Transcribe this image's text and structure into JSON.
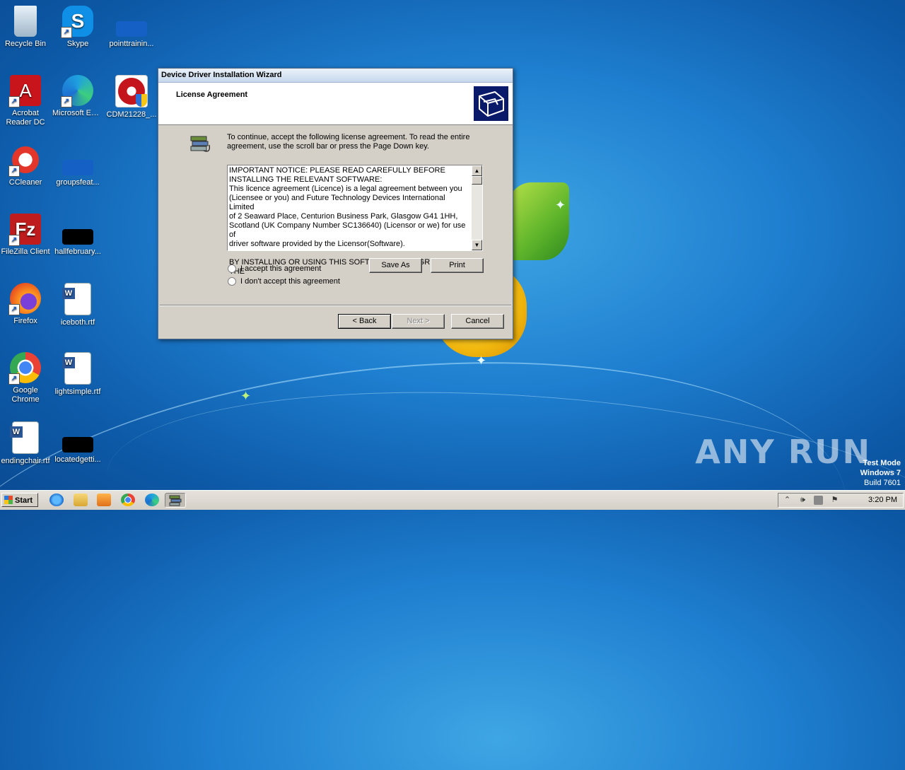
{
  "desktop": {
    "icons": [
      {
        "label": "Recycle Bin"
      },
      {
        "label": "Skype"
      },
      {
        "label": "pointtrainin..."
      },
      {
        "label": "Acrobat Reader DC"
      },
      {
        "label": "Microsoft Edge"
      },
      {
        "label": "CDM21228_..."
      },
      {
        "label": "CCleaner"
      },
      {
        "label": "groupsfeat..."
      },
      {
        "label": "FileZilla Client"
      },
      {
        "label": "hallfebruary..."
      },
      {
        "label": "Firefox"
      },
      {
        "label": "iceboth.rtf"
      },
      {
        "label": "Google Chrome"
      },
      {
        "label": "lightsimple.rtf"
      },
      {
        "label": "endingchair.rtf"
      },
      {
        "label": "locatedgetti..."
      }
    ],
    "watermark": "ANY RUN",
    "test_mode": {
      "line1": "Test Mode",
      "line2": "Windows 7",
      "line3": "Build 7601"
    }
  },
  "dialog": {
    "title": "Device Driver Installation Wizard",
    "header_title": "License Agreement",
    "instructions": "To continue, accept the following license agreement. To read the entire agreement, use the scroll bar or press the Page Down key.",
    "license_lines": [
      "IMPORTANT NOTICE: PLEASE READ CAREFULLY BEFORE",
      "INSTALLING THE RELEVANT SOFTWARE:",
      "This licence agreement (Licence) is a legal agreement between you",
      "(Licensee or you) and Future Technology Devices International Limited",
      "of 2 Seaward Place, Centurion Business Park, Glasgow G41 1HH,",
      "Scotland (UK Company Number SC136640) (Licensor or we) for use of",
      "driver software provided by the Licensor(Software).",
      "",
      "BY INSTALLING OR USING THIS SOFTWARE YOU AGREE TO THE"
    ],
    "radio_accept": "I accept this agreement",
    "radio_decline": "I don't accept this agreement",
    "save_as": "Save As",
    "print": "Print",
    "back": "< Back",
    "next": "Next >",
    "cancel": "Cancel"
  },
  "taskbar": {
    "start": "Start",
    "clock": "3:20 PM"
  }
}
